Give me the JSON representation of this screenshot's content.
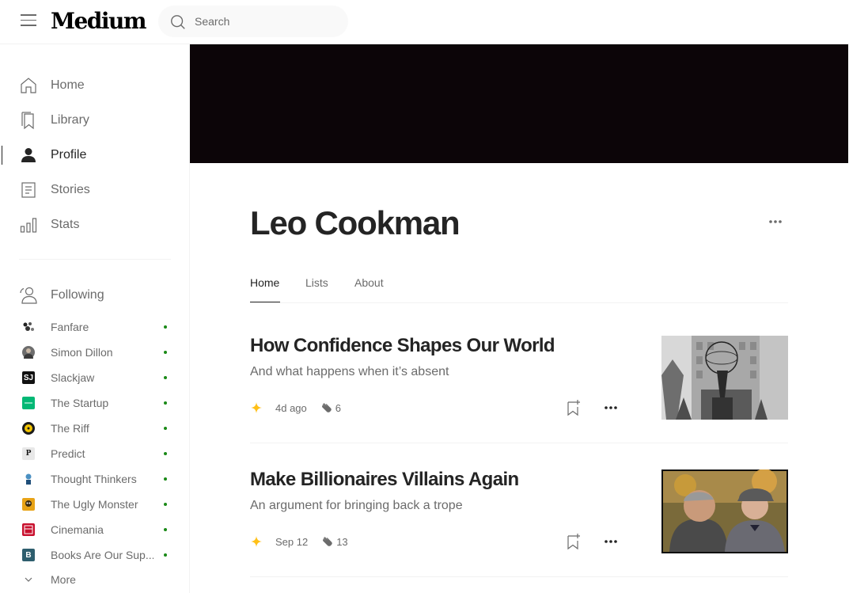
{
  "header": {
    "logo": "Medium",
    "search": {
      "placeholder": "Search"
    }
  },
  "sidebar": {
    "nav": [
      {
        "label": "Home",
        "icon": "home-icon"
      },
      {
        "label": "Library",
        "icon": "bookmark-icon"
      },
      {
        "label": "Profile",
        "icon": "profile-icon",
        "active": true
      },
      {
        "label": "Stories",
        "icon": "stories-icon"
      },
      {
        "label": "Stats",
        "icon": "stats-icon"
      }
    ],
    "following": {
      "label": "Following",
      "items": [
        {
          "name": "Fanfare"
        },
        {
          "name": "Simon Dillon"
        },
        {
          "name": "Slackjaw"
        },
        {
          "name": "The Startup"
        },
        {
          "name": "The Riff"
        },
        {
          "name": "Predict"
        },
        {
          "name": "Thought Thinkers"
        },
        {
          "name": "The Ugly Monster"
        },
        {
          "name": "Cinemania"
        },
        {
          "name": "Books Are Our Sup..."
        }
      ],
      "more_label": "More"
    }
  },
  "profile": {
    "name": "Leo Cookman",
    "tabs": [
      {
        "label": "Home",
        "active": true
      },
      {
        "label": "Lists"
      },
      {
        "label": "About"
      }
    ]
  },
  "articles": [
    {
      "title": "How Confidence Shapes Our World",
      "subtitle": "And what happens when it’s absent",
      "date": "4d ago",
      "claps": "6"
    },
    {
      "title": "Make Billionaires Villains Again",
      "subtitle": "An argument for bringing back a trope",
      "date": "Sep 12",
      "claps": "13"
    }
  ],
  "colors": {
    "accent_star": "#ffc017",
    "follow_dot": "#1a8917",
    "banner": "#0c0508",
    "text": "#242424",
    "muted": "#6b6b6b"
  }
}
